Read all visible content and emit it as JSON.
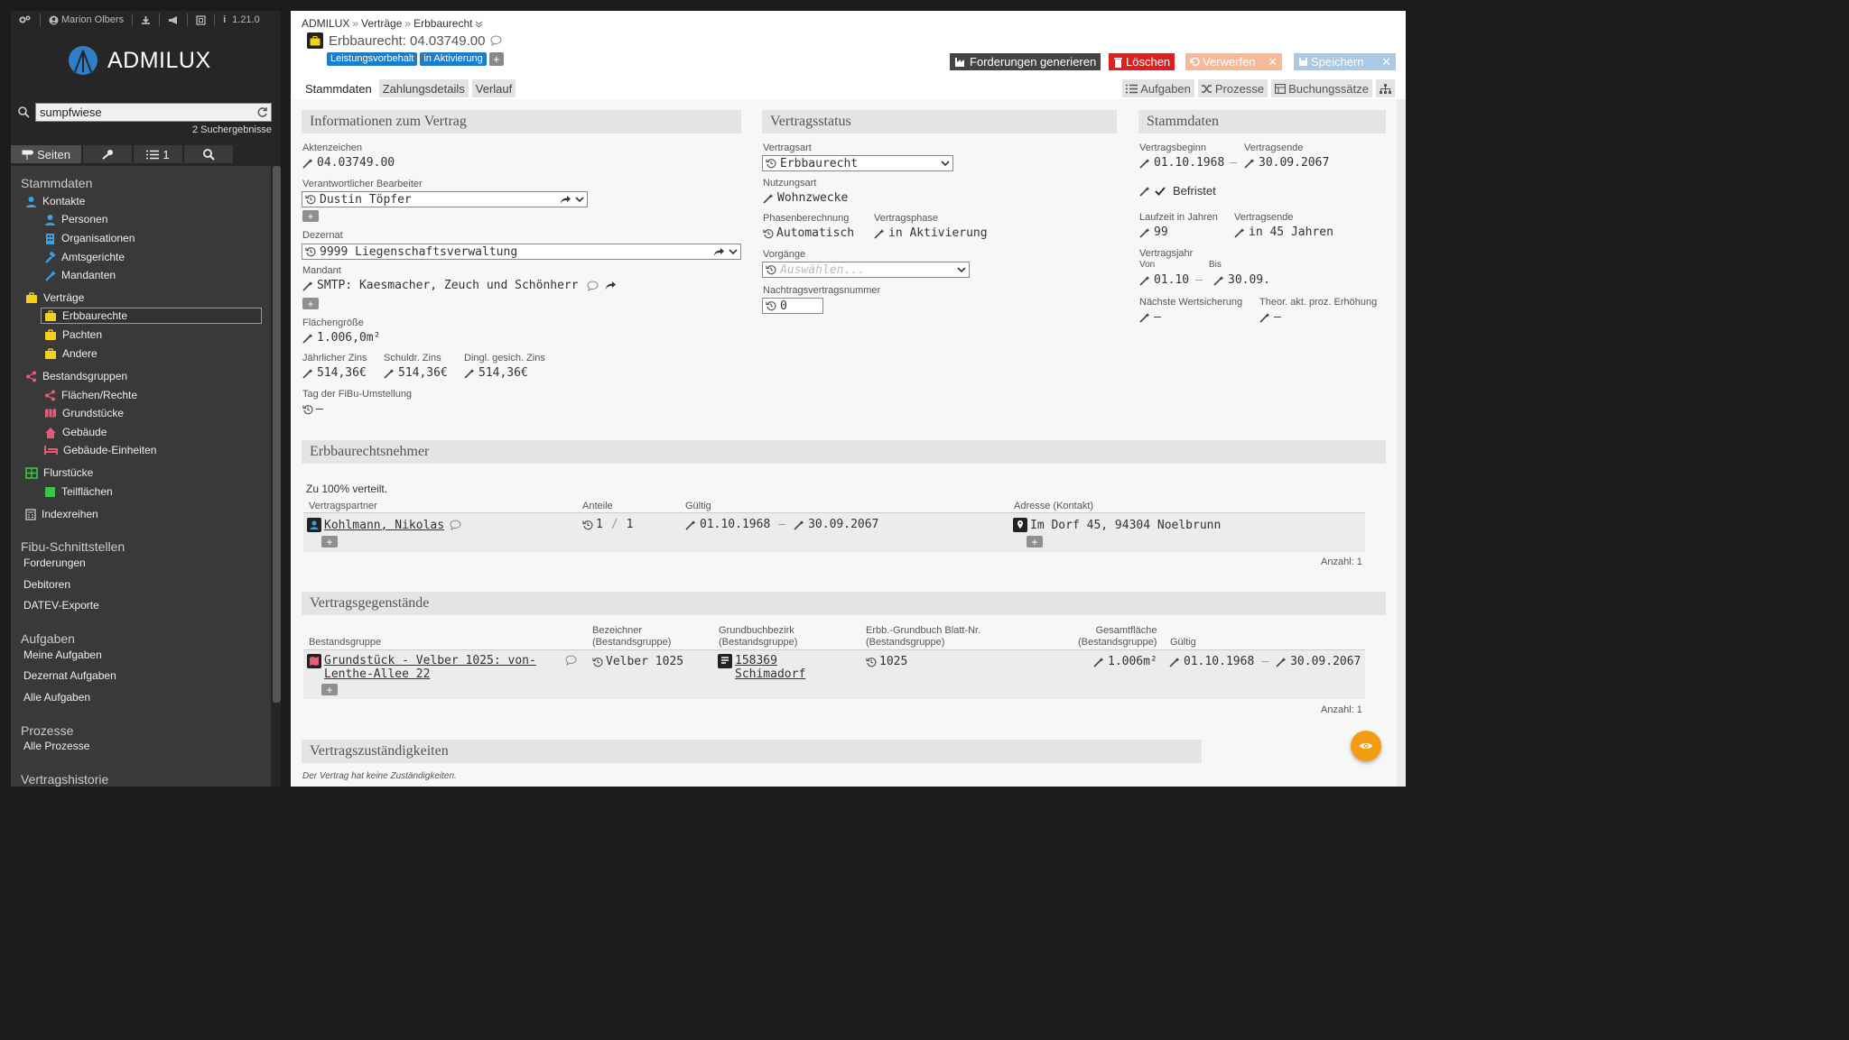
{
  "topbar": {
    "user": "Marion Olbers",
    "version": "1.21.0"
  },
  "brand": "ADMILUX",
  "search": {
    "value": "sumpfwiese",
    "results": "2 Suchergebnisse"
  },
  "sidebar_tabs": {
    "pages": "Seiten",
    "tasks_count": "1"
  },
  "nav": {
    "stammdaten": "Stammdaten",
    "kontakte": "Kontakte",
    "personen": "Personen",
    "organisationen": "Organisationen",
    "amtsgerichte": "Amtsgerichte",
    "mandanten": "Mandanten",
    "vertraege": "Verträge",
    "erbbaurechte": "Erbbaurechte",
    "pachten": "Pachten",
    "andere": "Andere",
    "bestandsgruppen": "Bestandsgruppen",
    "flaechen": "Flächen/Rechte",
    "grundstuecke": "Grundstücke",
    "gebaeude": "Gebäude",
    "gebaeude_einheiten": "Gebäude-Einheiten",
    "flurstuecke": "Flurstücke",
    "teilflaechen": "Teilflächen",
    "indexreihen": "Indexreihen",
    "fibu": "Fibu-Schnittstellen",
    "forderungen": "Forderungen",
    "debitoren": "Debitoren",
    "datev": "DATEV-Exporte",
    "aufgaben": "Aufgaben",
    "meine": "Meine Aufgaben",
    "dezernat": "Dezernat Aufgaben",
    "alle": "Alle Aufgaben",
    "prozesse": "Prozesse",
    "alle_prozesse": "Alle Prozesse",
    "historie": "Vertragshistorie"
  },
  "breadcrumb": {
    "root": "ADMILUX",
    "l1": "Verträge",
    "l2": "Erbbaurecht"
  },
  "title": "Erbbaurecht: 04.03749.00",
  "tags": [
    "Leistungsvorbehalt",
    "in Aktivierung"
  ],
  "buttons": {
    "generate": "Forderungen generieren",
    "delete": "Löschen",
    "discard": "Verwerfen",
    "save": "Speichern"
  },
  "colors": {
    "accent": "#1e7dc8",
    "delete": "#e02020",
    "discard": "#f6b99a",
    "save": "#a9c9e4",
    "fab": "#f39c12"
  },
  "tabs": [
    "Stammdaten",
    "Zahlungsdetails",
    "Verlauf"
  ],
  "right_tabs": [
    "Aufgaben",
    "Prozesse",
    "Buchungssätze"
  ],
  "vertrag": {
    "head": "Informationen zum Vertrag",
    "aktenzeichen_l": "Aktenzeichen",
    "aktenzeichen": "04.03749.00",
    "bearbeiter_l": "Verantwortlicher Bearbeiter",
    "bearbeiter": "Dustin Töpfer",
    "dezernat_l": "Dezernat",
    "dezernat": "9999 Liegenschaftsverwaltung",
    "mandant_l": "Mandant",
    "mandant": "SMTP: Kaesmacher, Zeuch und Schönherr",
    "flaeche_l": "Flächengröße",
    "flaeche": "1.006,0m²",
    "zins1_l": "Jährlicher Zins",
    "zins1": "514,36€",
    "zins2_l": "Schuldr. Zins",
    "zins2": "514,36€",
    "zins3_l": "Dingl. gesich. Zins",
    "zins3": "514,36€",
    "fibu_l": "Tag der FiBu-Umstellung",
    "fibu": "–"
  },
  "status": {
    "head": "Vertragsstatus",
    "art_l": "Vertragsart",
    "art": "Erbbaurecht",
    "nutzung_l": "Nutzungsart",
    "nutzung": "Wohnzwecke",
    "phasenb_l": "Phasenberechnung",
    "phasenb": "Automatisch",
    "phase_l": "Vertragsphase",
    "phase": "in Aktivierung",
    "vorgaenge_l": "Vorgänge",
    "vorgaenge_ph": "Auswählen...",
    "nachtrag_l": "Nachtragsvertragsnummer",
    "nachtrag": "0"
  },
  "stamm": {
    "head": "Stammdaten",
    "beginn_l": "Vertragsbeginn",
    "beginn": "01.10.1968",
    "ende_l": "Vertragsende",
    "ende": "30.09.2067",
    "befristet": "Befristet",
    "laufzeit_l": "Laufzeit in Jahren",
    "laufzeit": "99",
    "ende2_l": "Vertragsende",
    "ende2": "in 45 Jahren",
    "vjahr_l": "Vertragsjahr",
    "von_l": "Von",
    "von": "01.10",
    "bis_l": "Bis",
    "bis": "30.09.",
    "wert_l": "Nächste Wertsicherung",
    "wert": "–",
    "theor_l": "Theor. akt. proz. Erhöhung",
    "theor": "–"
  },
  "nehmer": {
    "head": "Erbbaurechtsnehmer",
    "verteilt": "Zu 100% verteilt.",
    "cols": [
      "Vertragspartner",
      "Anteile",
      "Gültig",
      "Adresse (Kontakt)"
    ],
    "partner": "Kohlmann, Nikolas",
    "anteil_a": "1",
    "anteil_b": "1",
    "von": "01.10.1968",
    "bis": "30.09.2067",
    "adresse": "Im Dorf 45, 94304 Noelbrunn",
    "anzahl": "Anzahl: 1"
  },
  "gegen": {
    "head": "Vertragsgegenstände",
    "c1": "Bestandsgruppe",
    "c2a": "Bezeichner",
    "c2b": "(Bestandsgruppe)",
    "c3a": "Grundbuchbezirk",
    "c3b": "(Bestandsgruppe)",
    "c4a": "Erbb.-Grundbuch Blatt-Nr.",
    "c4b": "(Bestandsgruppe)",
    "c5a": "Gesamtfläche",
    "c5b": "(Bestandsgruppe)",
    "c6": "Gültig",
    "bg1": "Grundstück - Velber 1025: von-",
    "bg2": "Lenthe-Allee 22",
    "bez": "Velber 1025",
    "gb1": "158369",
    "gb2": "Schimadorf",
    "blatt": "1025",
    "flaeche": "1.006m²",
    "von": "01.10.1968",
    "bis": "30.09.2067",
    "anzahl": "Anzahl: 1"
  },
  "zust": {
    "head": "Vertragszuständigkeiten",
    "empty": "Der Vertrag hat keine Zuständigkeiten."
  }
}
